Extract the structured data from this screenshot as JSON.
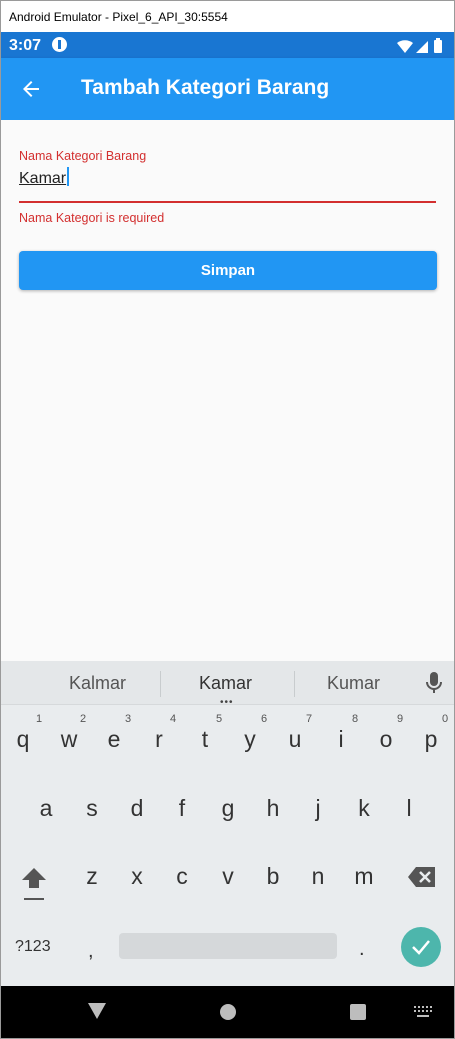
{
  "window": {
    "title": "Android Emulator - Pixel_6_API_30:5554"
  },
  "statusbar": {
    "time": "3:07"
  },
  "appbar": {
    "title": "Tambah Kategori Barang"
  },
  "form": {
    "label": "Nama Kategori Barang",
    "value": "Kamar",
    "error": "Nama Kategori is required",
    "save_label": "Simpan"
  },
  "keyboard": {
    "suggestions": [
      "Kalmar",
      "Kamar",
      "Kumar"
    ],
    "row1": [
      {
        "ch": "q",
        "hint": "1"
      },
      {
        "ch": "w",
        "hint": "2"
      },
      {
        "ch": "e",
        "hint": "3"
      },
      {
        "ch": "r",
        "hint": "4"
      },
      {
        "ch": "t",
        "hint": "5"
      },
      {
        "ch": "y",
        "hint": "6"
      },
      {
        "ch": "u",
        "hint": "7"
      },
      {
        "ch": "i",
        "hint": "8"
      },
      {
        "ch": "o",
        "hint": "9"
      },
      {
        "ch": "p",
        "hint": "0"
      }
    ],
    "row2": [
      "a",
      "s",
      "d",
      "f",
      "g",
      "h",
      "j",
      "k",
      "l"
    ],
    "row3": [
      "z",
      "x",
      "c",
      "v",
      "b",
      "n",
      "m"
    ],
    "symbols_label": "?123",
    "comma": ",",
    "period": "."
  },
  "colors": {
    "primary": "#2196f3",
    "statusbar": "#1976d2",
    "error": "#d32f2f",
    "enter_key": "#4db6ac"
  }
}
